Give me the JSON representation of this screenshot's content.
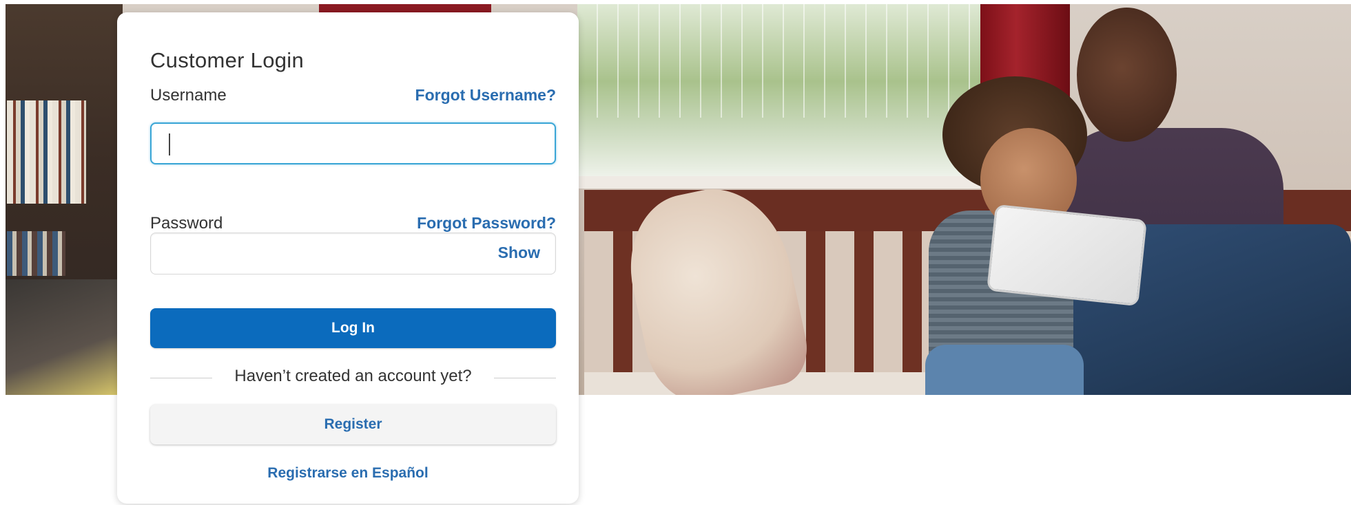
{
  "hero": {
    "image": "family-using-tablet-photo"
  },
  "login": {
    "title": "Customer Login",
    "username": {
      "label": "Username",
      "forgot_link": "Forgot Username?",
      "value": ""
    },
    "password": {
      "label": "Password",
      "forgot_link": "Forgot Password?",
      "value": "",
      "show_toggle": "Show"
    },
    "login_button": "Log In",
    "divider_text": "Haven’t created an account yet?",
    "register_button": "Register",
    "spanish_link": "Registrarse en Español"
  },
  "colors": {
    "primary": "#0b6bbd",
    "link": "#2a6db0",
    "focus": "#3aa6d6"
  }
}
